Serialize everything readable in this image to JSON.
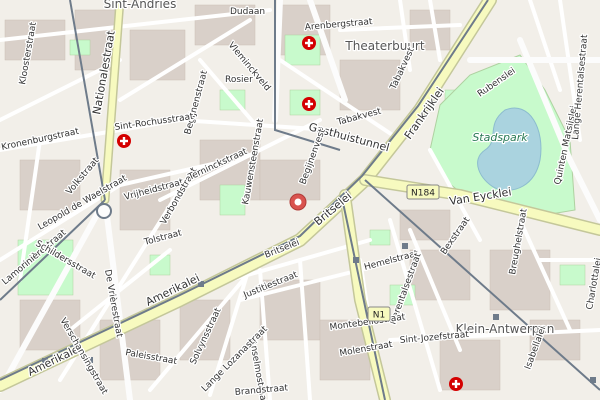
{
  "map": {
    "districts": {
      "theaterbuurt": "Theaterbuurt",
      "klein_antwerpen": "Klein-Antwerpen",
      "sint_andries": "Sint-Andries"
    },
    "parks": {
      "stadspark": "Stadspark"
    },
    "roads": {
      "frankrijklei": "Frankrijklei",
      "britselei": "Britselei",
      "amerikalei": "Amerikalei",
      "van_eycklei": "Van Eycklei",
      "nationalestraat": "Nationalestraat",
      "gasthuistunnel": "Gasthuistunnel",
      "rubenslei": "Rubenslei",
      "quinten_matsijslei": "Quinten Matsijslei",
      "lange_herentalsestraat": "Lange Herentalsestraat",
      "charlottalei": "Charlottalei",
      "tabakvest": "Tabakvest",
      "arenbergstraat": "Arenbergstraat",
      "dudaan": "Dudaan",
      "kronenburgstraat": "Kronenburgstraat",
      "volkstraat": "Volkstraat",
      "vrijheidstraat": "Vrijheidstraat",
      "verbondstraat": "Verbondstraat",
      "tolstraat": "Tolstraat",
      "lange_gasthuisstraat": "Kauwensteenstraat",
      "begijnenvest": "Begijnenvest",
      "justitiestraat": "Justitiestraat",
      "hemelstraat": "Hemelstraat",
      "herentalsestraat": "Herentalsestraat",
      "montebellostraat": "Montebellostraat",
      "bexstraat": "Bexstraat",
      "sint_jozefstraat": "Sint-Jozefstraat",
      "molenstraat": "Molenstraat",
      "anselmostraat": "Anselmostraat",
      "lange_lozanastraat": "Lange Lozanastraat",
      "solvynsstraat": "Solvynsstraat",
      "paleisstraat": "Paleisstraat",
      "verschansingstraat": "Verschansingstraat",
      "lamorinierestraat": "Lamorinièrestraat",
      "schildersstraat": "Schildersstraat",
      "leopold_de_waelstraat": "Leopold de Waelstraat",
      "brederodestraat": "Brederodestraat",
      "de_vrieresstraat": "De Vrièrestraat",
      "terninckstraat": "Terninckstraat",
      "begijnenstraat": "Begijnenstraat",
      "vlamingstraat": "Vleminckveld",
      "rosier": "Rosier",
      "breughelstraat": "Breughelstraat",
      "isabellalei": "Isabellalei",
      "sint_rochus": "Sint-Rochusstraat",
      "kloosterstraat": "Kloosterstraat",
      "kronenburgstraat2": "Kronenburgstraat",
      "brandstraat": "Brandstraat"
    },
    "shields": {
      "n184": "N184",
      "n1": "N1"
    },
    "colors": {
      "background": "#f2efe9",
      "building": "#d9d0c9",
      "park": "#c8facc",
      "park_dark": "#aed1a0",
      "water": "#aad3df",
      "primary_road": "#f7fabf",
      "primary_casing": "#c4c79a",
      "tram": "#6e7b8a",
      "hospital": "#d40000",
      "marker": "#d9534f"
    },
    "icons": {
      "hospital": "hospital-cross-icon",
      "marker": "location-pin-icon"
    }
  }
}
